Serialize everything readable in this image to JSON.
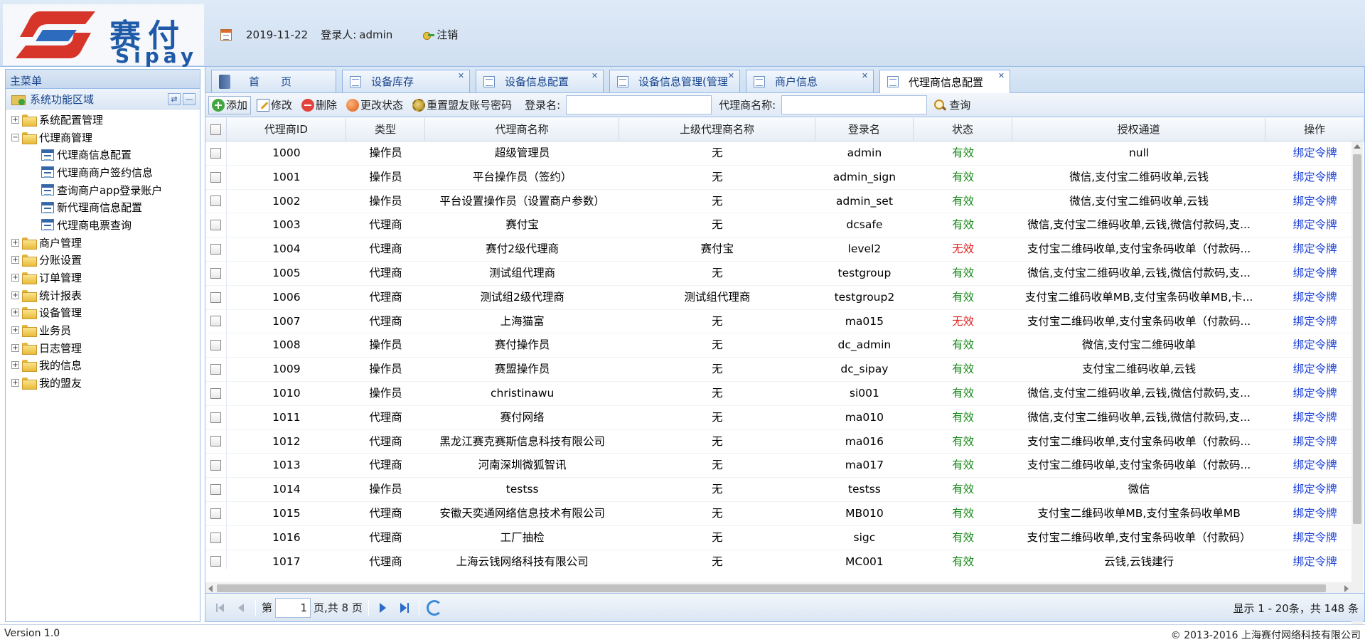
{
  "header": {
    "logo_cn": "赛付",
    "logo_en": "Sipay",
    "date": "2019-11-22",
    "user_label": "登录人:",
    "user_name": "admin",
    "logout_label": "注销"
  },
  "sidebar": {
    "title": "主菜单",
    "section_title": "系统功能区域",
    "items": [
      {
        "label": "系统配置管理",
        "type": "folder",
        "expanded": false
      },
      {
        "label": "代理商管理",
        "type": "folder",
        "expanded": true
      },
      {
        "label": "代理商信息配置",
        "type": "leaf"
      },
      {
        "label": "代理商商户签约信息",
        "type": "leaf"
      },
      {
        "label": "查询商户app登录账户",
        "type": "leaf"
      },
      {
        "label": "新代理商信息配置",
        "type": "leaf"
      },
      {
        "label": "代理商电票查询",
        "type": "leaf"
      },
      {
        "label": "商户管理",
        "type": "folder",
        "expanded": false
      },
      {
        "label": "分账设置",
        "type": "folder",
        "expanded": false
      },
      {
        "label": "订单管理",
        "type": "folder",
        "expanded": false
      },
      {
        "label": "统计报表",
        "type": "folder",
        "expanded": false
      },
      {
        "label": "设备管理",
        "type": "folder",
        "expanded": false
      },
      {
        "label": "业务员",
        "type": "folder",
        "expanded": false
      },
      {
        "label": "日志管理",
        "type": "folder",
        "expanded": false
      },
      {
        "label": "我的信息",
        "type": "folder",
        "expanded": false
      },
      {
        "label": "我的盟友",
        "type": "folder",
        "expanded": false
      }
    ]
  },
  "tabs": [
    {
      "label": "首　　页",
      "closable": false,
      "active": false
    },
    {
      "label": "设备库存",
      "closable": true,
      "active": false
    },
    {
      "label": "设备信息配置",
      "closable": true,
      "active": false
    },
    {
      "label": "设备信息管理(管理",
      "closable": true,
      "active": false
    },
    {
      "label": "商户信息",
      "closable": true,
      "active": false
    },
    {
      "label": "代理商信息配置",
      "closable": true,
      "active": true
    }
  ],
  "toolbar": {
    "add_label": "添加",
    "edit_label": "修改",
    "delete_label": "删除",
    "change_status_label": "更改状态",
    "reset_password_label": "重置盟友账号密码",
    "login_name_label": "登录名:",
    "login_name_value": "",
    "agent_name_label": "代理商名称:",
    "agent_name_value": "",
    "search_label": "查询"
  },
  "table": {
    "headers": [
      "代理商ID",
      "类型",
      "代理商名称",
      "上级代理商名称",
      "登录名",
      "状态",
      "授权通道",
      "操作"
    ],
    "rows": [
      {
        "id": "1000",
        "type": "操作员",
        "name": "超级管理员",
        "parent": "无",
        "login": "admin",
        "status": "有效",
        "channel": "null",
        "op": "绑定令牌"
      },
      {
        "id": "1001",
        "type": "操作员",
        "name": "平台操作员（签约）",
        "parent": "无",
        "login": "admin_sign",
        "status": "有效",
        "channel": "微信,支付宝二维码收单,云钱",
        "op": "绑定令牌"
      },
      {
        "id": "1002",
        "type": "操作员",
        "name": "平台设置操作员（设置商户参数）",
        "parent": "无",
        "login": "admin_set",
        "status": "有效",
        "channel": "微信,支付宝二维码收单,云钱",
        "op": "绑定令牌"
      },
      {
        "id": "1003",
        "type": "代理商",
        "name": "赛付宝",
        "parent": "无",
        "login": "dcsafe",
        "status": "有效",
        "channel": "微信,支付宝二维码收单,云钱,微信付款码,支...",
        "op": "绑定令牌"
      },
      {
        "id": "1004",
        "type": "代理商",
        "name": "赛付2级代理商",
        "parent": "赛付宝",
        "login": "level2",
        "status": "无效",
        "channel": "支付宝二维码收单,支付宝条码收单（付款码...",
        "op": "绑定令牌"
      },
      {
        "id": "1005",
        "type": "代理商",
        "name": "测试组代理商",
        "parent": "无",
        "login": "testgroup",
        "status": "有效",
        "channel": "微信,支付宝二维码收单,云钱,微信付款码,支...",
        "op": "绑定令牌"
      },
      {
        "id": "1006",
        "type": "代理商",
        "name": "测试组2级代理商",
        "parent": "测试组代理商",
        "login": "testgroup2",
        "status": "有效",
        "channel": "支付宝二维码收单MB,支付宝条码收单MB,卡...",
        "op": "绑定令牌"
      },
      {
        "id": "1007",
        "type": "代理商",
        "name": "上海猫富",
        "parent": "无",
        "login": "ma015",
        "status": "无效",
        "channel": "支付宝二维码收单,支付宝条码收单（付款码...",
        "op": "绑定令牌"
      },
      {
        "id": "1008",
        "type": "操作员",
        "name": "赛付操作员",
        "parent": "无",
        "login": "dc_admin",
        "status": "有效",
        "channel": "微信,支付宝二维码收单",
        "op": "绑定令牌"
      },
      {
        "id": "1009",
        "type": "操作员",
        "name": "赛盟操作员",
        "parent": "无",
        "login": "dc_sipay",
        "status": "有效",
        "channel": "支付宝二维码收单,云钱",
        "op": "绑定令牌"
      },
      {
        "id": "1010",
        "type": "操作员",
        "name": "christinawu",
        "parent": "无",
        "login": "si001",
        "status": "有效",
        "channel": "微信,支付宝二维码收单,云钱,微信付款码,支...",
        "op": "绑定令牌"
      },
      {
        "id": "1011",
        "type": "代理商",
        "name": "赛付网络",
        "parent": "无",
        "login": "ma010",
        "status": "有效",
        "channel": "微信,支付宝二维码收单,云钱,微信付款码,支...",
        "op": "绑定令牌"
      },
      {
        "id": "1012",
        "type": "代理商",
        "name": "黑龙江赛克赛斯信息科技有限公司",
        "parent": "无",
        "login": "ma016",
        "status": "有效",
        "channel": "支付宝二维码收单,支付宝条码收单（付款码...",
        "op": "绑定令牌"
      },
      {
        "id": "1013",
        "type": "代理商",
        "name": "河南深圳微狐智讯",
        "parent": "无",
        "login": "ma017",
        "status": "有效",
        "channel": "支付宝二维码收单,支付宝条码收单（付款码...",
        "op": "绑定令牌"
      },
      {
        "id": "1014",
        "type": "操作员",
        "name": "testss",
        "parent": "无",
        "login": "testss",
        "status": "有效",
        "channel": "微信",
        "op": "绑定令牌"
      },
      {
        "id": "1015",
        "type": "代理商",
        "name": "安徽天奕通网络信息技术有限公司",
        "parent": "无",
        "login": "MB010",
        "status": "有效",
        "channel": "支付宝二维码收单MB,支付宝条码收单MB",
        "op": "绑定令牌"
      },
      {
        "id": "1016",
        "type": "代理商",
        "name": "工厂抽检",
        "parent": "无",
        "login": "sigc",
        "status": "有效",
        "channel": "支付宝二维码收单,支付宝条码收单（付款码）",
        "op": "绑定令牌"
      },
      {
        "id": "1017",
        "type": "代理商",
        "name": "上海云钱网络科技有限公司",
        "parent": "无",
        "login": "MC001",
        "status": "有效",
        "channel": "云钱,云钱建行",
        "op": "绑定令牌"
      }
    ]
  },
  "pager": {
    "page_prefix": "第",
    "current_page": "1",
    "page_suffix": "页,共 8 页",
    "info": "显示 1 - 20条，共 148 条"
  },
  "footer": {
    "version": "Version 1.0",
    "copyright": "© 2013-2016 上海赛付网络科技有限公司"
  },
  "colors": {
    "valid": "#1a8a1a",
    "invalid": "#e02020",
    "link": "#1a3fd6",
    "accent": "#15428b"
  }
}
